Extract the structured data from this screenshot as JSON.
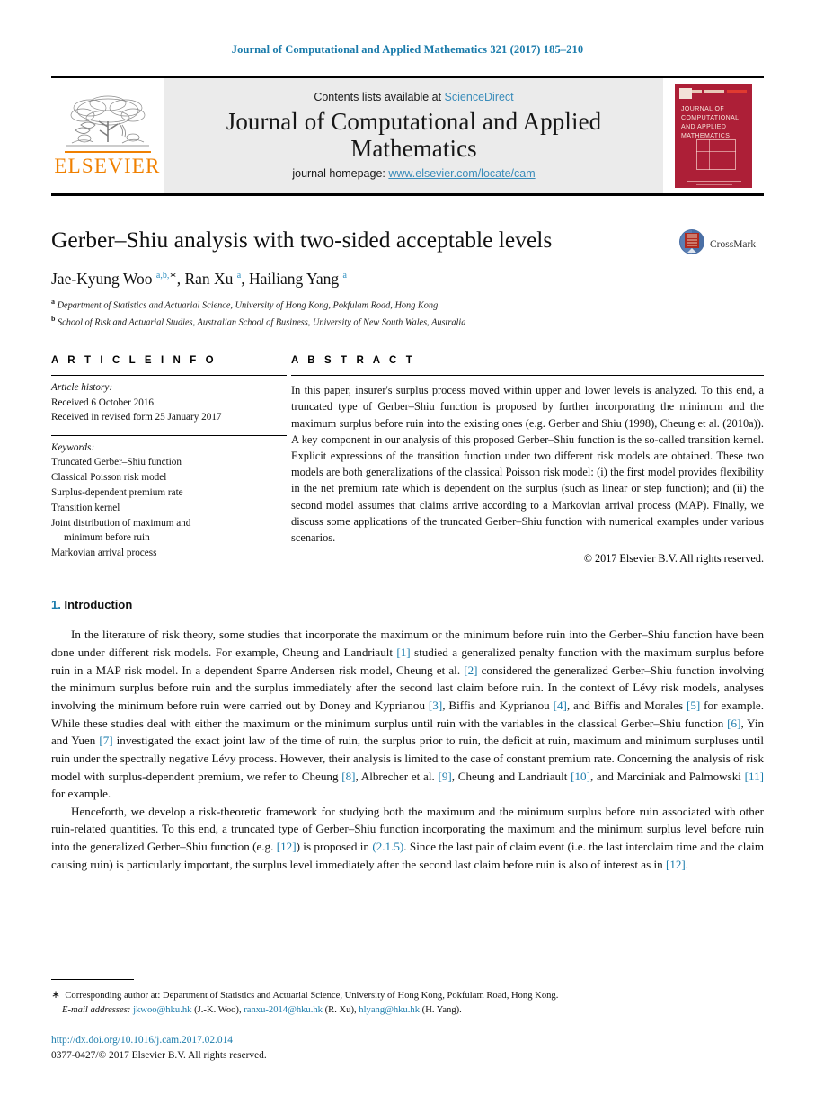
{
  "running_head": "Journal of Computational and Applied Mathematics 321 (2017) 185–210",
  "masthead": {
    "publisher_logo_name": "elsevier-logo",
    "publisher_wordmark": "ELSEVIER",
    "contents_prefix": "Contents lists available at ",
    "contents_link": "ScienceDirect",
    "journal_title": "Journal of Computational and Applied Mathematics",
    "homepage_prefix": "journal homepage: ",
    "homepage_url": "www.elsevier.com/locate/cam",
    "cover_title": "JOURNAL OF COMPUTATIONAL AND APPLIED MATHEMATICS"
  },
  "article": {
    "title": "Gerber–Shiu analysis with two-sided acceptable levels",
    "crossmark_label": "CrossMark",
    "authors_html": "Jae-Kyung Woo <sup>a,b,<span class=\"star\">∗</span></sup>, Ran Xu <sup>a</sup>, Hailiang Yang <sup>a</sup>",
    "affiliations": [
      {
        "mark": "a",
        "text": "Department of Statistics and Actuarial Science, University of Hong Kong, Pokfulam Road, Hong Kong"
      },
      {
        "mark": "b",
        "text": "School of Risk and Actuarial Studies, Australian School of Business, University of New South Wales, Australia"
      }
    ]
  },
  "article_info": {
    "heading": "A R T I C L E   I N F O",
    "history_label": "Article history:",
    "history": [
      "Received 6 October 2016",
      "Received in revised form 25 January 2017"
    ],
    "keywords_label": "Keywords:",
    "keywords": [
      {
        "text": "Truncated Gerber–Shiu function",
        "indent": false
      },
      {
        "text": "Classical Poisson risk model",
        "indent": false
      },
      {
        "text": "Surplus-dependent premium rate",
        "indent": false
      },
      {
        "text": "Transition kernel",
        "indent": false
      },
      {
        "text": "Joint distribution of maximum and",
        "indent": false
      },
      {
        "text": "minimum before ruin",
        "indent": true
      },
      {
        "text": "Markovian arrival process",
        "indent": false
      }
    ]
  },
  "abstract": {
    "heading": "A B S T R A C T",
    "text": "In this paper, insurer's surplus process moved within upper and lower levels is analyzed. To this end, a truncated type of Gerber–Shiu function is proposed by further incorporating the minimum and the maximum surplus before ruin into the existing ones (e.g. Gerber and Shiu (1998), Cheung et al. (2010a)). A key component in our analysis of this proposed Gerber–Shiu function is the so-called transition kernel. Explicit expressions of the transition function under two different risk models are obtained. These two models are both generalizations of the classical Poisson risk model: (i) the first model provides flexibility in the net premium rate which is dependent on the surplus (such as linear or step function); and (ii) the second model assumes that claims arrive according to a Markovian arrival process (MAP). Finally, we discuss some applications of the truncated Gerber–Shiu function with numerical examples under various scenarios.",
    "copyright": "© 2017 Elsevier B.V. All rights reserved."
  },
  "introduction": {
    "number": "1.",
    "title": "Introduction",
    "paragraph_1_html": "In the literature of risk theory, some studies that incorporate the maximum or the minimum before ruin into the Gerber–Shiu function have been done under different risk models. For example, Cheung and Landriault <span class=\"ref\">[1]</span> studied a generalized penalty function with the maximum surplus before ruin in a MAP risk model. In a dependent Sparre Andersen risk model, Cheung et al. <span class=\"ref\">[2]</span> considered the generalized Gerber–Shiu function involving the minimum surplus before ruin and the surplus immediately after the second last claim before ruin. In the context of Lévy risk models, analyses involving the minimum before ruin were carried out by Doney and Kyprianou <span class=\"ref\">[3]</span>, Biffis and Kyprianou <span class=\"ref\">[4]</span>, and Biffis and Morales <span class=\"ref\">[5]</span> for example. While these studies deal with either the maximum or the minimum surplus until ruin with the variables in the classical Gerber–Shiu function <span class=\"ref\">[6]</span>, Yin and Yuen <span class=\"ref\">[7]</span> investigated the exact joint law of the time of ruin, the surplus prior to ruin, the deficit at ruin, maximum and minimum surpluses until ruin under the spectrally negative Lévy process. However, their analysis is limited to the case of constant premium rate. Concerning the analysis of risk model with surplus-dependent premium, we refer to Cheung <span class=\"ref\">[8]</span>, Albrecher et al. <span class=\"ref\">[9]</span>, Cheung and Landriault <span class=\"ref\">[10]</span>, and Marciniak and Palmowski <span class=\"ref\">[11]</span> for example.",
    "paragraph_2_html": "Henceforth, we develop a risk-theoretic framework for studying both the maximum and the minimum surplus before ruin associated with other ruin-related quantities. To this end, a truncated type of Gerber–Shiu function incorporating the maximum and the minimum surplus level before ruin into the generalized Gerber–Shiu function (e.g. <span class=\"ref\">[12]</span>) is proposed in <span class=\"ref\">(2.1.5)</span>. Since the last pair of claim event (i.e. the last interclaim time and the claim causing ruin) is particularly important, the surplus level immediately after the second last claim before ruin is also of interest as in <span class=\"ref\">[12]</span>."
  },
  "footnotes": {
    "corresponding_html": "<span class=\"star\">∗</span>&nbsp; Corresponding author at: Department of Statistics and Actuarial Science, University of Hong Kong, Pokfulam Road, Hong Kong.",
    "emails_html": "<span class=\"ital\">E-mail addresses:</span> <span class=\"fn-mail\">jkwoo@hku.hk</span> (J.-K. Woo), <span class=\"fn-mail\">ranxu-2014@hku.hk</span> (R. Xu), <span class=\"fn-mail\">hlyang@hku.hk</span> (H. Yang).",
    "doi": "http://dx.doi.org/10.1016/j.cam.2017.02.014",
    "issn": "0377-0427/© 2017 Elsevier B.V. All rights reserved."
  },
  "colors": {
    "link_blue": "#1a7bab",
    "sciencedirect_blue": "#3a8cba",
    "elsevier_orange": "#f08000",
    "cover_red": "#ad1f37",
    "masthead_grey": "#ebebeb"
  }
}
